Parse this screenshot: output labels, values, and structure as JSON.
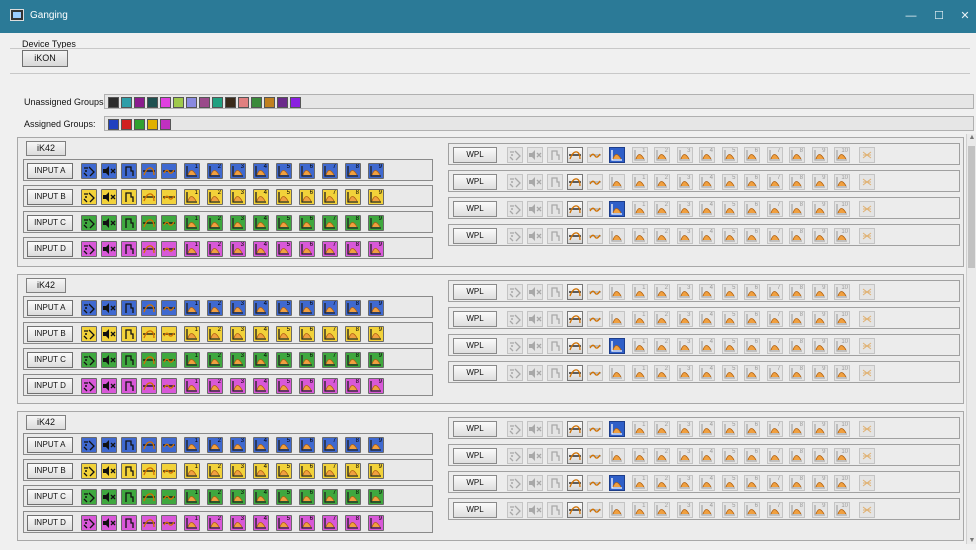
{
  "window": {
    "title": "Ganging",
    "minimize_glyph": "—",
    "maximize_glyph": "☐",
    "close_glyph": "✕"
  },
  "device_types": {
    "label": "Device Types",
    "button_label": "iKON"
  },
  "groups": {
    "unassigned_label": "Unassigned Groups:",
    "assigned_label": "Assigned Groups:",
    "unassigned_colors": [
      "#2b2b2b",
      "#2e9ea8",
      "#8a1c8e",
      "#1e5050",
      "#e040e0",
      "#9ec94a",
      "#8a8ae0",
      "#9a4a8a",
      "#20a080",
      "#3a2a1a",
      "#e08080",
      "#3a8a3a",
      "#c08020",
      "#6a2a8a",
      "#8a20e0"
    ],
    "assigned_colors": [
      "#2040c0",
      "#d02020",
      "#30a030",
      "#e0b000",
      "#c030c0"
    ]
  },
  "input_colors": {
    "A": "#3f69d0",
    "B": "#f2d23a",
    "C": "#3fa83f",
    "D": "#d858d8"
  },
  "icon_names": [
    "phase-icon",
    "mute-icon",
    "gate-icon",
    "hpf-icon",
    "lpf-icon",
    "eq-band-icon"
  ],
  "blocks": [
    {
      "device_label": "iK42",
      "inputs": [
        {
          "label": "INPUT A",
          "color": "A"
        },
        {
          "label": "INPUT B",
          "color": "B"
        },
        {
          "label": "INPUT C",
          "color": "C"
        },
        {
          "label": "INPUT D",
          "color": "D"
        }
      ],
      "wpl_rows": [
        {
          "label": "WPL",
          "eq1_selected": true
        },
        {
          "label": "WPL",
          "eq1_selected": false
        },
        {
          "label": "WPL",
          "eq1_selected": true
        },
        {
          "label": "WPL",
          "eq1_selected": false
        }
      ]
    },
    {
      "device_label": "iK42",
      "inputs": [
        {
          "label": "INPUT A",
          "color": "A"
        },
        {
          "label": "INPUT B",
          "color": "B"
        },
        {
          "label": "INPUT C",
          "color": "C"
        },
        {
          "label": "INPUT D",
          "color": "D"
        }
      ],
      "wpl_rows": [
        {
          "label": "WPL",
          "eq1_selected": false
        },
        {
          "label": "WPL",
          "eq1_selected": false
        },
        {
          "label": "WPL",
          "eq1_selected": true
        },
        {
          "label": "WPL",
          "eq1_selected": false
        }
      ]
    },
    {
      "device_label": "iK42",
      "inputs": [
        {
          "label": "INPUT A",
          "color": "A"
        },
        {
          "label": "INPUT B",
          "color": "B"
        },
        {
          "label": "INPUT C",
          "color": "C"
        },
        {
          "label": "INPUT D",
          "color": "D"
        }
      ],
      "wpl_rows": [
        {
          "label": "WPL",
          "eq1_selected": true
        },
        {
          "label": "WPL",
          "eq1_selected": false
        },
        {
          "label": "WPL",
          "eq1_selected": true
        },
        {
          "label": "WPL",
          "eq1_selected": false
        }
      ]
    }
  ],
  "input_band_numbers": [
    "1",
    "2",
    "3",
    "4",
    "5",
    "6",
    "7",
    "8",
    "9"
  ],
  "wpl_band_numbers": [
    "",
    "1",
    "2",
    "3",
    "4",
    "5",
    "6",
    "7",
    "8",
    "9",
    "10"
  ]
}
